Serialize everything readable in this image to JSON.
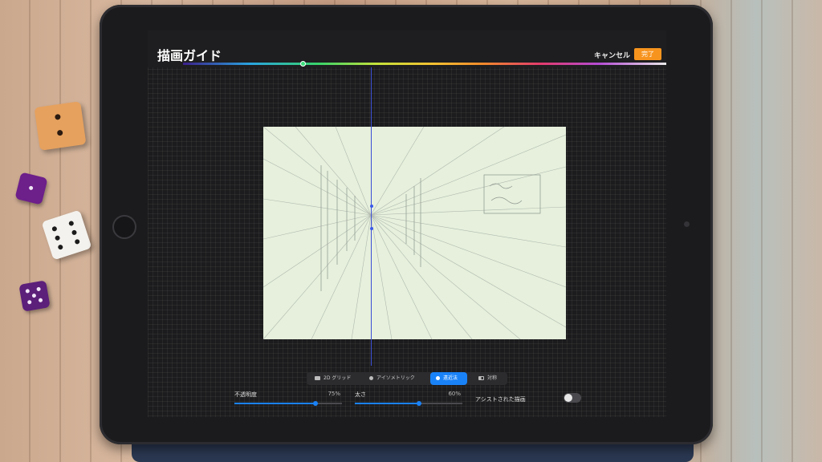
{
  "header": {
    "title": "描画ガイド",
    "cancel_label": "キャンセル",
    "done_label": "完了"
  },
  "modes": {
    "grid_2d": "2D グリッド",
    "isometric": "アイソメトリック",
    "perspective": "遠近法",
    "symmetry": "対称",
    "active": "perspective"
  },
  "controls": {
    "opacity_label": "不透明度",
    "opacity_value": "75%",
    "opacity_fraction": 0.75,
    "thickness_label": "太さ",
    "thickness_value": "60%",
    "thickness_fraction": 0.6,
    "assist_label": "アシストされた描画",
    "assist_on": false
  },
  "colors": {
    "accent": "#1a82f7",
    "done_button": "#f7941e",
    "guide": "#3c4fd6"
  },
  "icons": [
    "grid-icon",
    "isometric-icon",
    "perspective-icon",
    "symmetry-icon"
  ]
}
